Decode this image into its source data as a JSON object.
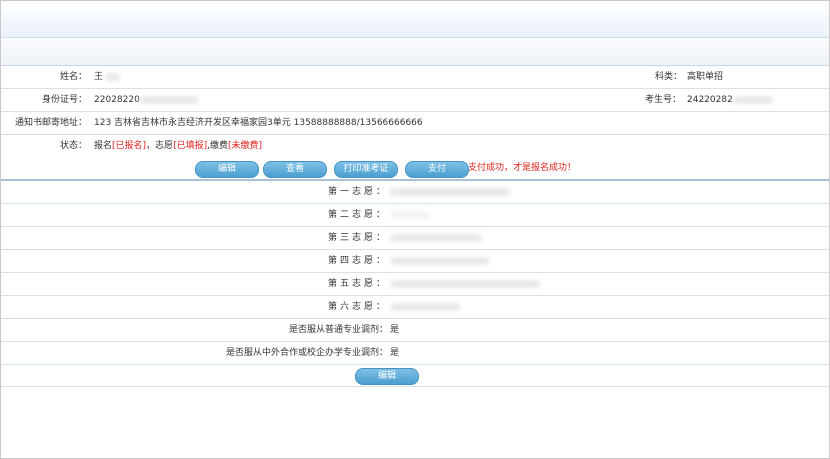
{
  "profile": {
    "name_label": "姓名：",
    "name_value": "王",
    "category_label": "科类：",
    "category_value": "高职单招",
    "id_label": "身份证号：",
    "id_value": "22028220",
    "exam_no_label": "考生号：",
    "exam_no_value": "24220282",
    "address_label": "通知书邮寄地址：",
    "address_value": "123 吉林省吉林市永吉经济开发区幸福家园3单元 13588888888/13566666666",
    "status_label": "状态：",
    "status_registration_prefix": "报名",
    "status_registration_value": "[已报名]",
    "status_choice_prefix": "，志愿",
    "status_choice_value": "[已填报]",
    "status_payment_prefix": ",缴费",
    "status_payment_value": "[未缴费]"
  },
  "actions": {
    "edit_label": "编辑",
    "view_label": "查看",
    "print_label": "打印准考证",
    "pay_label": "支付",
    "notice": "支付成功，才是报名成功！"
  },
  "choices": {
    "items": [
      {
        "label": "第一志愿：",
        "value": ""
      },
      {
        "label": "第二志愿：",
        "value": ""
      },
      {
        "label": "第三志愿：",
        "value": ""
      },
      {
        "label": "第四志愿：",
        "value": ""
      },
      {
        "label": "第五志愿：",
        "value": ""
      },
      {
        "label": "第六志愿：",
        "value": ""
      }
    ],
    "general_adjust_label": "是否服从普通专业调剂：",
    "general_adjust_value": "是",
    "coop_adjust_label": "是否服从中外合作或校企办学专业调剂：",
    "coop_adjust_value": "是",
    "edit_label": "编辑"
  }
}
